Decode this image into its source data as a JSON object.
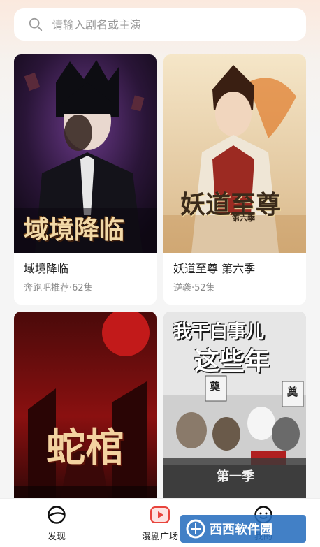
{
  "search": {
    "placeholder": "请输入剧名或主演"
  },
  "cards": [
    {
      "title": "域境降临",
      "meta": "奔跑吧推荐·62集",
      "poster_text": "域境降临"
    },
    {
      "title": "妖道至尊 第六季",
      "meta": "逆袭·52集",
      "poster_text": "妖道至尊",
      "poster_subtext": "第六季"
    },
    {
      "title": "",
      "meta": "",
      "poster_text": "蛇棺"
    },
    {
      "title": "",
      "meta": "",
      "poster_text_line1": "我干白事儿",
      "poster_text_line2": "这些年",
      "poster_badge": "第一季",
      "poster_sign_left": "奠",
      "poster_sign_right": "奠"
    }
  ],
  "tabbar": {
    "items": [
      {
        "label": "发现",
        "icon": "compass-icon"
      },
      {
        "label": "漫剧广场",
        "icon": "play-icon"
      },
      {
        "label": "我的",
        "icon": "smile-icon"
      }
    ]
  },
  "watermark": {
    "text": "西西软件园"
  },
  "colors": {
    "accent": "#e8443c",
    "header_tint": "#fbe9de",
    "background": "#f5f5f5"
  }
}
